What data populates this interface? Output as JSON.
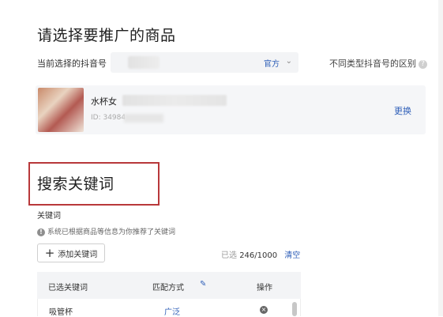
{
  "page": {
    "title": "请选择要推广的商品"
  },
  "account": {
    "label": "当前选择的抖音号",
    "selected": "官方",
    "help_text": "不同类型抖音号的区别",
    "help_icon": "question-circle-icon"
  },
  "product": {
    "name_prefix": "水杯女",
    "id_prefix": "ID: 34984",
    "change_label": "更换"
  },
  "keywords": {
    "section_title": "搜索关键词",
    "field_label": "关键词",
    "notice": "系统已根据商品等信息为你推荐了关键词",
    "add_button": "添加关键词",
    "count_prefix": "已选",
    "count": "246/1000",
    "clear_label": "清空",
    "table": {
      "headers": [
        "已选关键词",
        "匹配方式",
        "操作"
      ],
      "rows": [
        {
          "keyword": "吸管杯",
          "match": "广泛"
        }
      ]
    }
  },
  "colors": {
    "accent": "#2f5fb8",
    "highlight_border": "#b8383a"
  }
}
